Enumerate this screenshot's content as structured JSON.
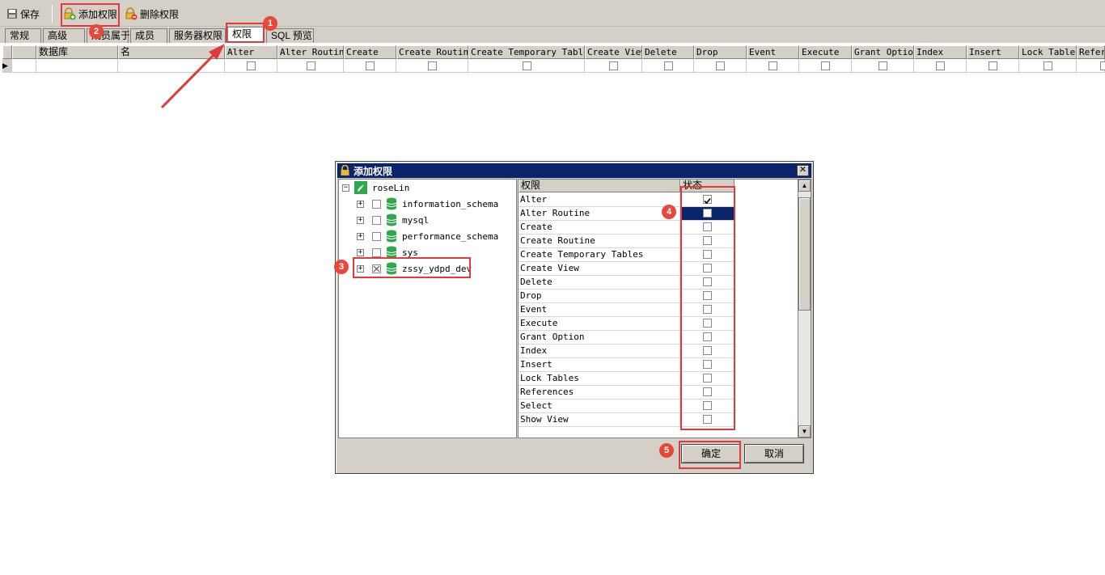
{
  "toolbar": {
    "save_label": "保存",
    "add_priv_label": "添加权限",
    "delete_priv_label": "删除权限"
  },
  "tabs": [
    {
      "label": "常规"
    },
    {
      "label": "高级"
    },
    {
      "label": "成员属于"
    },
    {
      "label": "成员"
    },
    {
      "label": "服务器权限"
    },
    {
      "label": "权限",
      "active": true
    },
    {
      "label": "SQL 预览"
    }
  ],
  "grid": {
    "columns": [
      "数据库",
      "名",
      "Alter",
      "Alter Routine",
      "Create",
      "Create Routine",
      "Create Temporary Tables",
      "Create View",
      "Delete",
      "Drop",
      "Event",
      "Execute",
      "Grant Option",
      "Index",
      "Insert",
      "Lock Tables",
      "Refer"
    ],
    "row_indicator": "▶"
  },
  "dialog": {
    "title": "添加权限",
    "close_glyph": "✕",
    "tree": {
      "root": "roseLin",
      "databases": [
        {
          "name": "information_schema",
          "state": "unchecked"
        },
        {
          "name": "mysql",
          "state": "unchecked"
        },
        {
          "name": "performance_schema",
          "state": "unchecked"
        },
        {
          "name": "sys",
          "state": "unchecked"
        },
        {
          "name": "zssy_ydpd_dev",
          "state": "partial"
        }
      ]
    },
    "privileges_header": "权限",
    "state_header": "状态",
    "privileges": [
      {
        "name": "Alter",
        "checked": true
      },
      {
        "name": "Alter Routine",
        "checked": false,
        "selected": true
      },
      {
        "name": "Create",
        "checked": false
      },
      {
        "name": "Create Routine",
        "checked": false
      },
      {
        "name": "Create Temporary Tables",
        "checked": false
      },
      {
        "name": "Create View",
        "checked": false
      },
      {
        "name": "Delete",
        "checked": false
      },
      {
        "name": "Drop",
        "checked": false
      },
      {
        "name": "Event",
        "checked": false
      },
      {
        "name": "Execute",
        "checked": false
      },
      {
        "name": "Grant Option",
        "checked": false
      },
      {
        "name": "Index",
        "checked": false
      },
      {
        "name": "Insert",
        "checked": false
      },
      {
        "name": "Lock Tables",
        "checked": false
      },
      {
        "name": "References",
        "checked": false
      },
      {
        "name": "Select",
        "checked": false
      },
      {
        "name": "Show View",
        "checked": false
      }
    ],
    "ok_label": "确定",
    "cancel_label": "取消"
  },
  "annotations": {
    "badges": [
      "1",
      "2",
      "3",
      "4",
      "5"
    ],
    "color": "#e23a3a"
  },
  "colors": {
    "titlebar": "#0a246a",
    "chrome": "#d4d0c8",
    "db_icon": "#2ea84a"
  },
  "icons": [
    "save-icon",
    "lock-add-icon",
    "lock-remove-icon",
    "lock-icon",
    "user-icon",
    "database-icon",
    "close-icon",
    "check-icon",
    "arrow-icon"
  ]
}
